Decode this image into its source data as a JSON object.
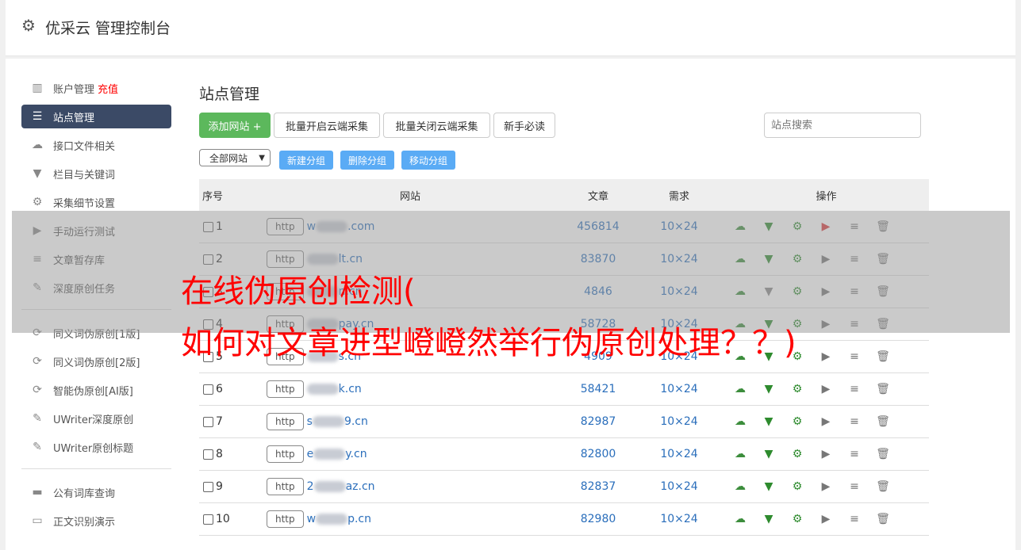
{
  "header": {
    "title": "优采云 管理控制台"
  },
  "sidebar": {
    "items": [
      {
        "label": "账户管理",
        "extra": "充值",
        "icon": "bar-chart-icon"
      },
      {
        "label": "站点管理",
        "icon": "server-icon",
        "active": true
      },
      {
        "label": "接口文件相关",
        "icon": "cloud-upload-icon"
      },
      {
        "label": "栏目与关键词",
        "icon": "filter-icon"
      },
      {
        "label": "采集细节设置",
        "icon": "gears-icon"
      },
      {
        "label": "手动运行测试",
        "icon": "play-icon"
      },
      {
        "label": "文章暂存库",
        "icon": "database-icon"
      },
      {
        "label": "深度原创任务",
        "icon": "edit-icon"
      }
    ],
    "items2": [
      {
        "label": "同义词伪原创[1版]",
        "icon": "refresh-icon"
      },
      {
        "label": "同义词伪原创[2版]",
        "icon": "refresh-icon"
      },
      {
        "label": "智能伪原创[AI版]",
        "icon": "refresh-icon"
      },
      {
        "label": "UWriter深度原创",
        "icon": "edit-icon"
      },
      {
        "label": "UWriter原创标题",
        "icon": "edit-icon"
      }
    ],
    "items3": [
      {
        "label": "公有词库查询",
        "icon": "book-icon"
      },
      {
        "label": "正文识别演示",
        "icon": "monitor-icon"
      }
    ]
  },
  "main": {
    "title": "站点管理",
    "buttons": {
      "add": "添加网站 +",
      "open": "批量开启云端采集",
      "close": "批量关闭云端采集",
      "guide": "新手必读"
    },
    "search_placeholder": "站点搜索",
    "group_select": "全部网站",
    "group_buttons": {
      "new": "新建分组",
      "delete": "删除分组",
      "move": "移动分组"
    },
    "columns": [
      "序号",
      "网站",
      "文章",
      "需求",
      "操作"
    ],
    "rows": [
      {
        "no": "1",
        "proto": "http",
        "pre": "w",
        "post": ".com",
        "articles": "456814",
        "demand": "10×24",
        "run_active": true
      },
      {
        "no": "2",
        "proto": "http",
        "pre": "",
        "post": "lt.cn",
        "articles": "83870",
        "demand": "10×24"
      },
      {
        "no": "3",
        "proto": "http",
        "pre": "",
        "post": "n.cn",
        "articles": "4846",
        "demand": "10×24"
      },
      {
        "no": "4",
        "proto": "http",
        "pre": "",
        "post": "pay.cn",
        "articles": "58728",
        "demand": "10×24"
      },
      {
        "no": "5",
        "proto": "http",
        "pre": "",
        "post": "s.cn",
        "articles": "4909",
        "demand": "10×24"
      },
      {
        "no": "6",
        "proto": "http",
        "pre": "",
        "post": "k.cn",
        "articles": "58421",
        "demand": "10×24"
      },
      {
        "no": "7",
        "proto": "http",
        "pre": "s",
        "post": "9.cn",
        "articles": "82987",
        "demand": "10×24"
      },
      {
        "no": "8",
        "proto": "http",
        "pre": "e",
        "post": "y.cn",
        "articles": "82800",
        "demand": "10×24"
      },
      {
        "no": "9",
        "proto": "http",
        "pre": "2",
        "post": "az.cn",
        "articles": "82837",
        "demand": "10×24"
      },
      {
        "no": "10",
        "proto": "http",
        "pre": "w",
        "post": "p.cn",
        "articles": "82980",
        "demand": "10×24"
      }
    ]
  },
  "overlay": {
    "line1": "在线伪原创检测(",
    "line2": "如何对文章进型嶝嶝然举行伪原创处理？？)"
  },
  "colors": {
    "accent": "#3b4a66",
    "green": "#5cb85c",
    "blue": "#5aabf5",
    "red": "#ff0000"
  }
}
